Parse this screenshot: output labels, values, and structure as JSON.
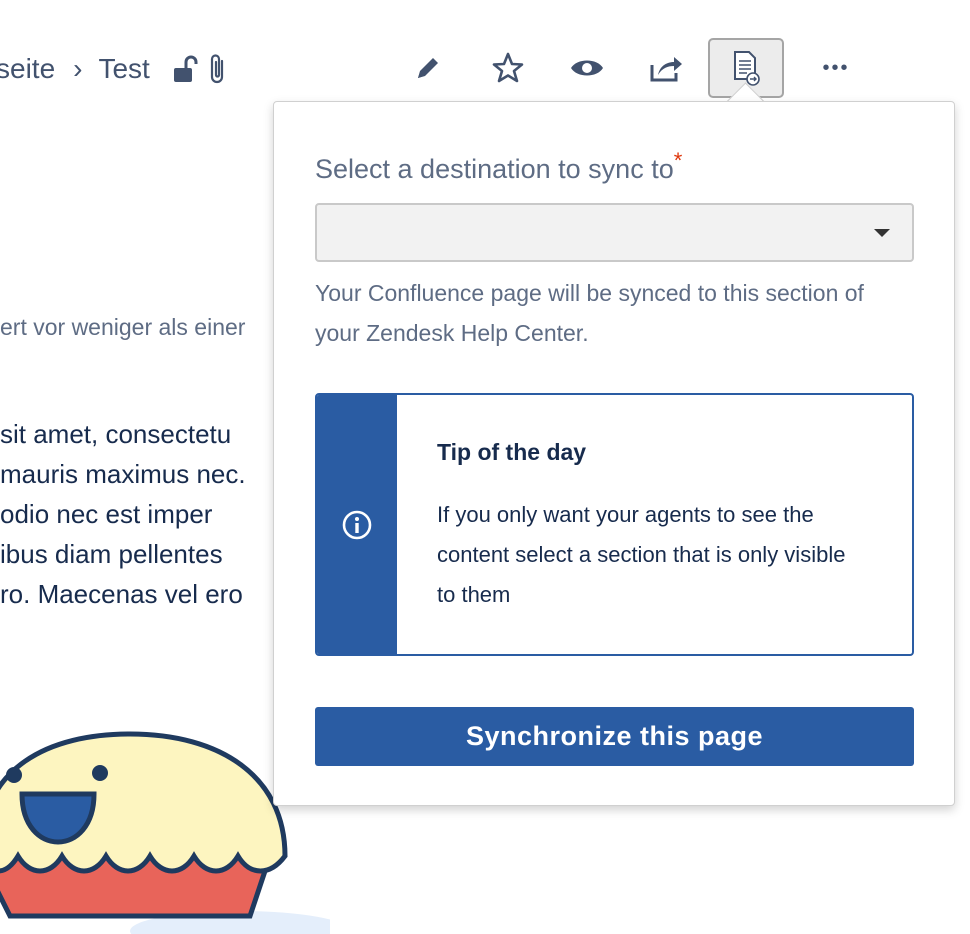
{
  "breadcrumb": {
    "parent": "seite",
    "separator": "›",
    "current": "Test"
  },
  "toolbar": {
    "items": [
      "pencil-icon",
      "star-icon",
      "eye-icon",
      "share-icon",
      "zendesk-sync-icon",
      "more-icon"
    ],
    "more_glyph": "•••"
  },
  "document": {
    "meta": "ert vor weniger als einer",
    "lines": [
      "sit amet, consectetu",
      "mauris  maximus  nec.",
      "odio  nec  est  imper",
      "ibus  diam  pellentes",
      "ro.  Maecenas  vel  ero"
    ]
  },
  "popover": {
    "field_label": "Select a destination to sync to",
    "required_mark": "*",
    "select_value": "",
    "help_text": "Your Confluence page will be synced to this section of your Zendesk Help Center.",
    "tip": {
      "title": "Tip of the day",
      "text": "If you only want your agents to see the content select a section that is only visible to them",
      "icon": "info-icon"
    },
    "submit_label": "Synchronize this page"
  },
  "colors": {
    "primary": "#2a5ca3",
    "required": "#de350b",
    "muted_text": "#5e6c84",
    "mascot_body": "#fdf5c0",
    "mascot_crust": "#e8645a",
    "mascot_outline": "#1f3a5f"
  }
}
